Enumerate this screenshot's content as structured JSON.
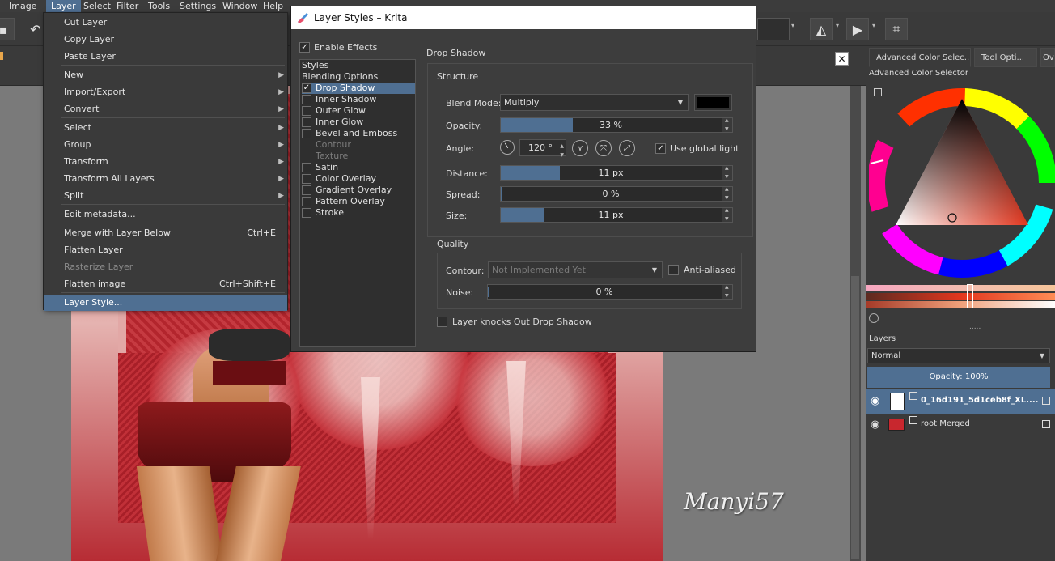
{
  "menubar": {
    "items": [
      "Image",
      "Layer",
      "Select",
      "Filter",
      "Tools",
      "Settings",
      "Window",
      "Help"
    ],
    "active_index": 1
  },
  "layer_menu": {
    "items": [
      {
        "label": "Cut Layer"
      },
      {
        "label": "Copy Layer"
      },
      {
        "label": "Paste Layer"
      },
      {
        "label": "New",
        "submenu": true
      },
      {
        "label": "Import/Export",
        "submenu": true
      },
      {
        "label": "Convert",
        "submenu": true
      },
      {
        "label": "Select",
        "submenu": true
      },
      {
        "label": "Group",
        "submenu": true
      },
      {
        "label": "Transform",
        "submenu": true
      },
      {
        "label": "Transform All Layers",
        "submenu": true
      },
      {
        "label": "Split",
        "submenu": true
      },
      {
        "label": "Edit metadata..."
      },
      {
        "label": "Merge with Layer Below",
        "shortcut": "Ctrl+E"
      },
      {
        "label": "Flatten Layer"
      },
      {
        "label": "Rasterize Layer",
        "disabled": true
      },
      {
        "label": "Flatten image",
        "shortcut": "Ctrl+Shift+E"
      },
      {
        "label": "Layer Style...",
        "selected": true
      }
    ]
  },
  "dialog": {
    "title": "Layer Styles – Krita",
    "enable_effects": "Enable Effects",
    "section_title": "Drop Shadow",
    "styles_list": [
      {
        "label": "Styles",
        "header": true
      },
      {
        "label": "Blending Options",
        "header": true
      },
      {
        "label": "Drop Shadow",
        "checked": true,
        "selected": true
      },
      {
        "label": "Inner Shadow"
      },
      {
        "label": "Outer Glow"
      },
      {
        "label": "Inner Glow"
      },
      {
        "label": "Bevel and Emboss"
      },
      {
        "label": "Contour",
        "disabled": true
      },
      {
        "label": "Texture",
        "disabled": true
      },
      {
        "label": "Satin"
      },
      {
        "label": "Color Overlay"
      },
      {
        "label": "Gradient Overlay"
      },
      {
        "label": "Pattern Overlay"
      },
      {
        "label": "Stroke"
      }
    ],
    "structure": {
      "title": "Structure",
      "blend_mode_label": "Blend Mode:",
      "blend_mode_value": "Multiply",
      "shadow_color": "#000000",
      "opacity_label": "Opacity:",
      "opacity_value": "33 %",
      "opacity_fraction": 0.33,
      "angle_label": "Angle:",
      "angle_value": "120 °",
      "use_global_light": "Use global light",
      "distance_label": "Distance:",
      "distance_value": "11 px",
      "distance_fraction": 0.27,
      "spread_label": "Spread:",
      "spread_value": "0 %",
      "spread_fraction": 0.0,
      "size_label": "Size:",
      "size_value": "11 px",
      "size_fraction": 0.2
    },
    "quality": {
      "title": "Quality",
      "contour_label": "Contour:",
      "contour_value": "Not Implemented Yet",
      "anti_aliased": "Anti-aliased",
      "noise_label": "Noise:",
      "noise_value": "0 %"
    },
    "knocks_out": "Layer knocks Out Drop Shadow"
  },
  "docker": {
    "tabs": [
      "Advanced Color Selec...",
      "Tool Opti...",
      "Ov"
    ],
    "panel_title": "Advanced Color Selector",
    "layers_title": "Layers",
    "blend_mode": "Normal",
    "opacity_label": "Opacity:  100%",
    "layers": [
      {
        "name": "0_16d191_5d1ceb8f_XL....",
        "selected": true
      },
      {
        "name": "root Merged",
        "selected": false
      }
    ]
  },
  "canvas": {
    "signature": "Manyi57"
  },
  "colors": {
    "accent": "#4f6f92",
    "menu_bg": "#3a3a3a",
    "canvas_bg": "#7a7a7a"
  }
}
